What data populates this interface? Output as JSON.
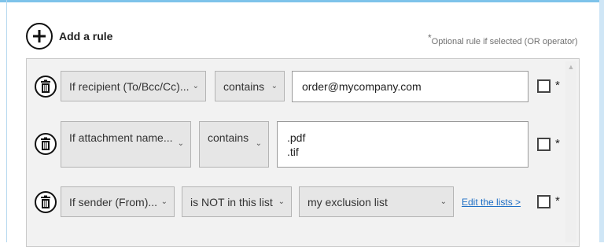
{
  "header": {
    "add_rule_label": "Add a rule",
    "optional_star": "*",
    "optional_note": "Optional rule if selected (OR operator)"
  },
  "rules": [
    {
      "condition": "If recipient (To/Bcc/Cc)...",
      "operator": "contains",
      "value_lines": [
        "order@mycompany.com"
      ],
      "optional_checked": false,
      "asterisk": "*"
    },
    {
      "condition": "If attachment name...",
      "operator": "contains",
      "value_lines": [
        ".pdf",
        ".tif"
      ],
      "optional_checked": false,
      "asterisk": "*"
    },
    {
      "condition": "If sender (From)...",
      "operator": "is NOT in this list",
      "list_value": "my exclusion list",
      "edit_link": "Edit the lists >",
      "optional_checked": false,
      "asterisk": "*"
    }
  ],
  "icons": {
    "add": "plus-circle-icon",
    "delete": "trash-icon",
    "dropdown": "chevron-down-icon",
    "scroll_up": "scroll-up-arrow-icon"
  },
  "colors": {
    "accent_bar": "#7ec3ea",
    "link": "#1e6fc5",
    "panel_bg": "#f2f2f2",
    "dropdown_bg": "#e6e6e6"
  }
}
